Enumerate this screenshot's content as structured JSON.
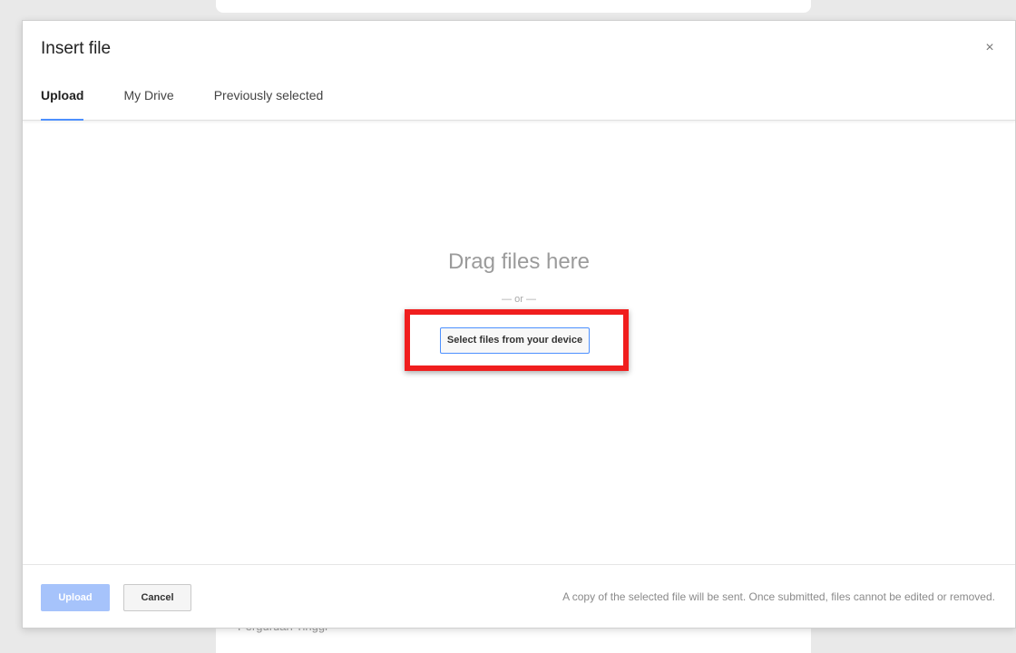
{
  "background": {
    "partial_text": "Perguruan Tinggi"
  },
  "dialog": {
    "title": "Insert file",
    "close_label": "×",
    "tabs": [
      {
        "label": "Upload",
        "active": true
      },
      {
        "label": "My Drive",
        "active": false
      },
      {
        "label": "Previously selected",
        "active": false
      }
    ],
    "drop_area": {
      "heading": "Drag files here",
      "separator": "— or —",
      "select_button_label": "Select files from your device"
    },
    "footer": {
      "upload_label": "Upload",
      "cancel_label": "Cancel",
      "note": "A copy of the selected file will be sent. Once submitted, files cannot be edited or removed."
    }
  },
  "colors": {
    "accent": "#4d90fe",
    "highlight": "#f01e1e",
    "upload_disabled": "#a6c3fb"
  },
  "icons": {
    "close": "close-icon"
  }
}
